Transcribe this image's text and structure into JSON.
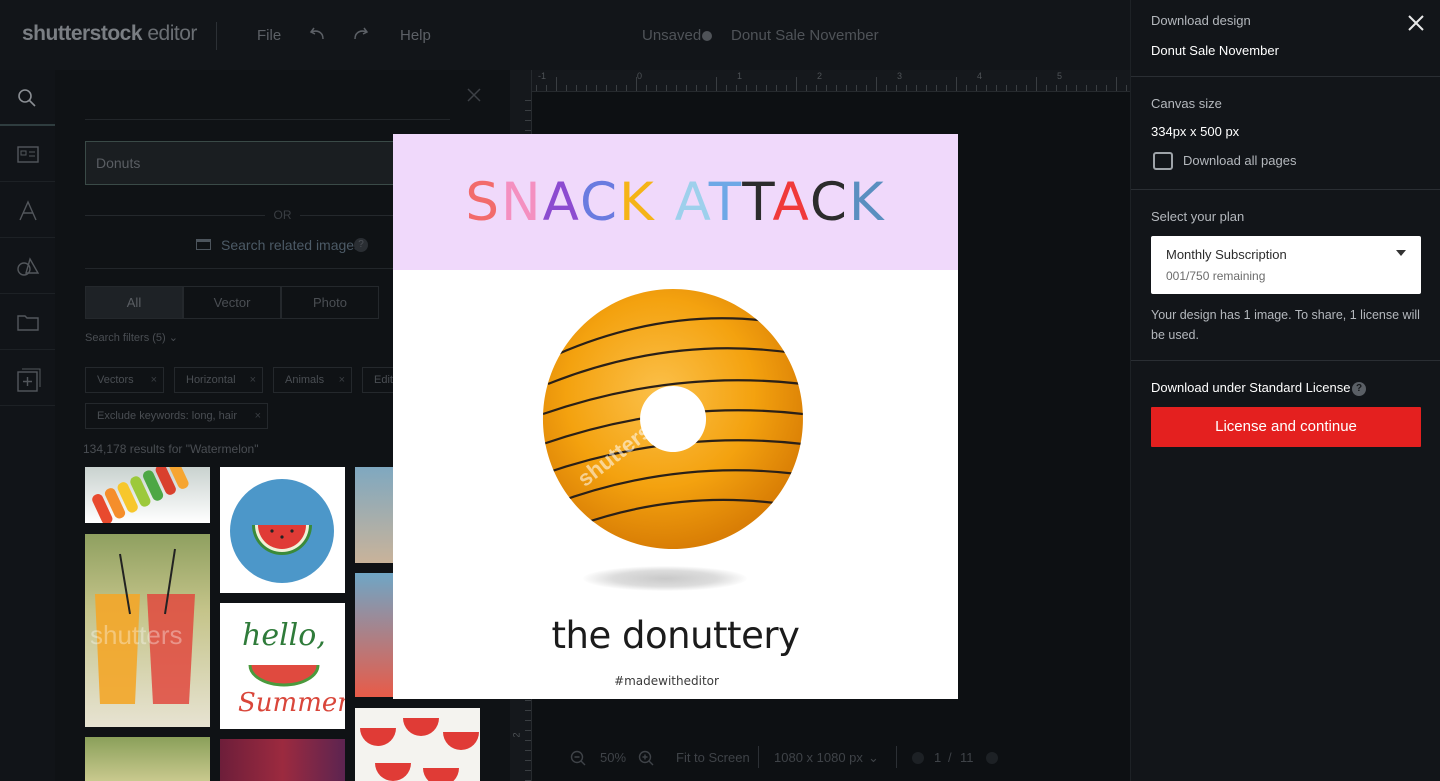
{
  "topbar": {
    "logo_bold": "shutterstock",
    "logo_light": " editor",
    "file_label": "File",
    "help_label": "Help",
    "status_label": "Unsaved",
    "document_title": "Donut Sale November"
  },
  "left_panel": {
    "search_value": "Donuts",
    "or_label": "OR",
    "related_label": "Search related images",
    "tabs": [
      "All",
      "Vector",
      "Photo"
    ],
    "filters_label": "Search filters (5)",
    "chips": [
      "Vectors",
      "Horizontal",
      "Animals",
      "Edito",
      "Exclude keywords: long, hair"
    ],
    "results_text": "134,178 results for \"Watermelon\""
  },
  "canvas": {
    "ruler_labels": [
      "-1",
      "0",
      "1",
      "2",
      "3",
      "4",
      "5"
    ],
    "left_ruler_label": "2",
    "zoom_value": "50%",
    "fit_label": "Fit to Screen",
    "size_label": "1080 x 1080 px",
    "page_current": "1",
    "page_total": "11"
  },
  "preview": {
    "headline_letters": [
      {
        "ch": "S",
        "color": "#f26b6b"
      },
      {
        "ch": "N",
        "color": "#f490c0"
      },
      {
        "ch": "A",
        "color": "#8c4bd0"
      },
      {
        "ch": "C",
        "color": "#6a7be0"
      },
      {
        "ch": "K",
        "color": "#f5b417"
      },
      {
        "ch": " ",
        "color": "#000000"
      },
      {
        "ch": "A",
        "color": "#9ed0ec"
      },
      {
        "ch": "T",
        "color": "#6ea8e6"
      },
      {
        "ch": "T",
        "color": "#2c2c2c"
      },
      {
        "ch": "A",
        "color": "#f03a3a"
      },
      {
        "ch": "C",
        "color": "#2c2c2c"
      },
      {
        "ch": "K",
        "color": "#5a8fc0"
      }
    ],
    "watermark": "shutterstock",
    "brand_name": "the donuttery",
    "hashtag": "#madewitheditor",
    "header_bg": "#f0d9fb",
    "donut_color": "#f4a20f"
  },
  "download": {
    "title": "Download design",
    "design_name": "Donut Sale November",
    "canvas_size_label": "Canvas size",
    "canvas_size_value": "334px x 500 px",
    "download_all_label": "Download all pages",
    "plan_label": "Select your plan",
    "plan_name": "Monthly Subscription",
    "plan_remaining": "001/750 remaining",
    "note": "Your design has 1 image. To share, 1 license will be used.",
    "license_label": "Download under Standard License",
    "cta_label": "License and continue",
    "accent_color": "#e4201f"
  }
}
